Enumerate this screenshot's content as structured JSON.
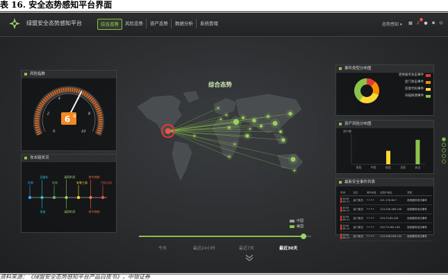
{
  "caption": "表 16. 安全态势感知平台界面",
  "source": "资料来源：《绿盟安全态势感知平台产品白皮书》，中银证券",
  "app": {
    "title": "绿盟安全态势感知平台"
  },
  "nav": {
    "tabs": [
      {
        "label": "综合态势",
        "active": true
      },
      {
        "label": "风险态势",
        "active": false
      },
      {
        "label": "资产态势",
        "active": false
      },
      {
        "label": "数据分析",
        "active": false
      },
      {
        "label": "系统管理",
        "active": false
      }
    ],
    "user_menu": "态势感知 ▾",
    "notification_count": "3",
    "icons": [
      "grid-icon",
      "bell-icon",
      "user-icon",
      "gear-icon",
      "power-icon"
    ]
  },
  "risk_index": {
    "title": "风险指数",
    "gauge": {
      "value": 6,
      "unit": "级",
      "min": 0,
      "max": 10,
      "ticks": [
        "0",
        "2",
        "4",
        "6",
        "8",
        "10"
      ]
    }
  },
  "attack_chain": {
    "title": "攻击链状况",
    "top_labels": [
      "侦查",
      "武器化",
      "投放",
      "漏洞利用",
      "安装工具",
      "命令控制",
      "目标达成"
    ],
    "bottom_labels": [
      "投放",
      "漏洞利用",
      "命令控制"
    ]
  },
  "map": {
    "title": "综合态势",
    "legend": [
      {
        "label": "中国",
        "color": "#9e9e9e"
      },
      {
        "label": "美国",
        "color": "#8bc34a"
      }
    ]
  },
  "time_range": {
    "options": [
      "今天",
      "最近24小时",
      "最近7天",
      "最近30天"
    ],
    "selected": "最近30天"
  },
  "event_types": {
    "title": "事件类型分布图",
    "chart_data": {
      "type": "pie",
      "categories": [
        "拒绝服务攻击事件",
        "后门攻击事件",
        "恶意代码事件",
        "扫描探测事件"
      ],
      "values": [
        12,
        18,
        30,
        40
      ],
      "colors": [
        "#e53935",
        "#fb8c00",
        "#fdd835",
        "#8bc34a"
      ]
    }
  },
  "asset_risk": {
    "title": "资产风险分布图",
    "chart_data": {
      "type": "bar",
      "categories": [
        "高危",
        "中危",
        "低危",
        "无危",
        "安全"
      ],
      "values": [
        0,
        0,
        22,
        0,
        40
      ],
      "colors": [
        "#e53935",
        "#fb8c00",
        "#fdd835",
        "#8bc34a",
        "#8bc34a"
      ],
      "ylabel": "资产数",
      "ylim": [
        0,
        50
      ]
    }
  },
  "events_list": {
    "title": "最新安全事件列表",
    "columns": [
      "时间",
      "攻击",
      "源IP地址",
      "目的IP地址",
      "类型"
    ],
    "rows": [
      {
        "time": "2016\n06-11",
        "attack": "后门攻击",
        "src": "*.*.*.*",
        "dst": "221.176.38.7",
        "type": "拒绝服务攻击事件"
      },
      {
        "time": "2016\n06-11",
        "attack": "后门攻击",
        "src": "*.*.*.*",
        "dst": "123.226.166.136",
        "type": "拒绝服务攻击事件"
      },
      {
        "time": "2016\n06-11",
        "attack": "后门攻击",
        "src": "*.*.*.*",
        "dst": "223.73.83.228",
        "type": "拒绝服务攻击事件"
      },
      {
        "time": "2016\n06-11",
        "attack": "后门攻击",
        "src": "*.*.*.*",
        "dst": "220.73.282.136",
        "type": "拒绝服务攻击事件"
      },
      {
        "time": "2016\n06-11",
        "attack": "后门攻击",
        "src": "*.*.*.*",
        "dst": "113.238.248.134",
        "type": "拒绝服务攻击事件"
      }
    ]
  },
  "side_nav": {
    "pages": 5,
    "current": 0
  }
}
